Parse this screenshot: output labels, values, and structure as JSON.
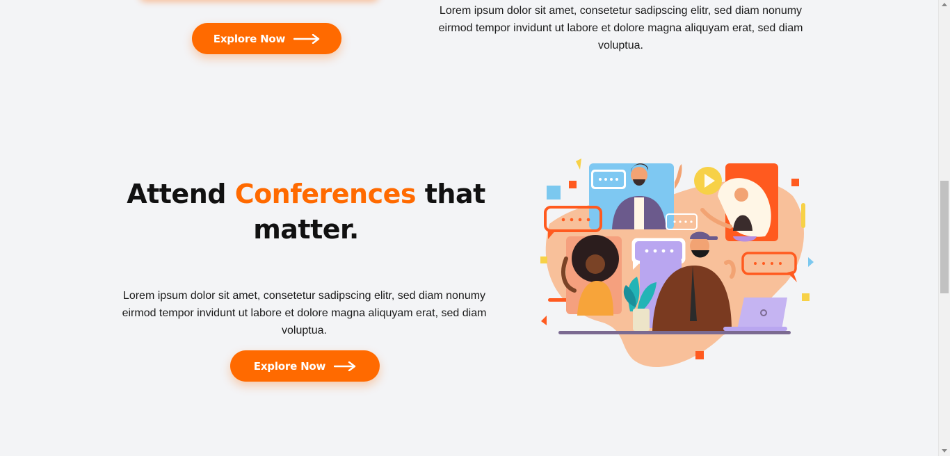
{
  "top_section": {
    "button_label": "Explore Now",
    "paragraph": "Lorem ipsum dolor sit amet, consetetur sadipscing elitr, sed diam nonumy eirmod tempor invidunt ut labore et dolore magna aliquyam erat, sed diam voluptua."
  },
  "conference_section": {
    "heading_part1": "Attend",
    "heading_accent": "Conferences",
    "heading_part2": "that matter.",
    "paragraph": "Lorem ipsum dolor sit amet, consetetur sadipscing elitr, sed diam nonumy eirmod tempor invidunt ut labore et dolore magna aliquyam erat, sed diam voluptua.",
    "button_label": "Explore Now",
    "illustration_icon": "video-conference-illustration"
  },
  "icons": {
    "button_arrow": "arrow-right-icon"
  },
  "colors": {
    "accent": "#ff6a00",
    "background": "#f3f4f6",
    "text": "#111111"
  }
}
